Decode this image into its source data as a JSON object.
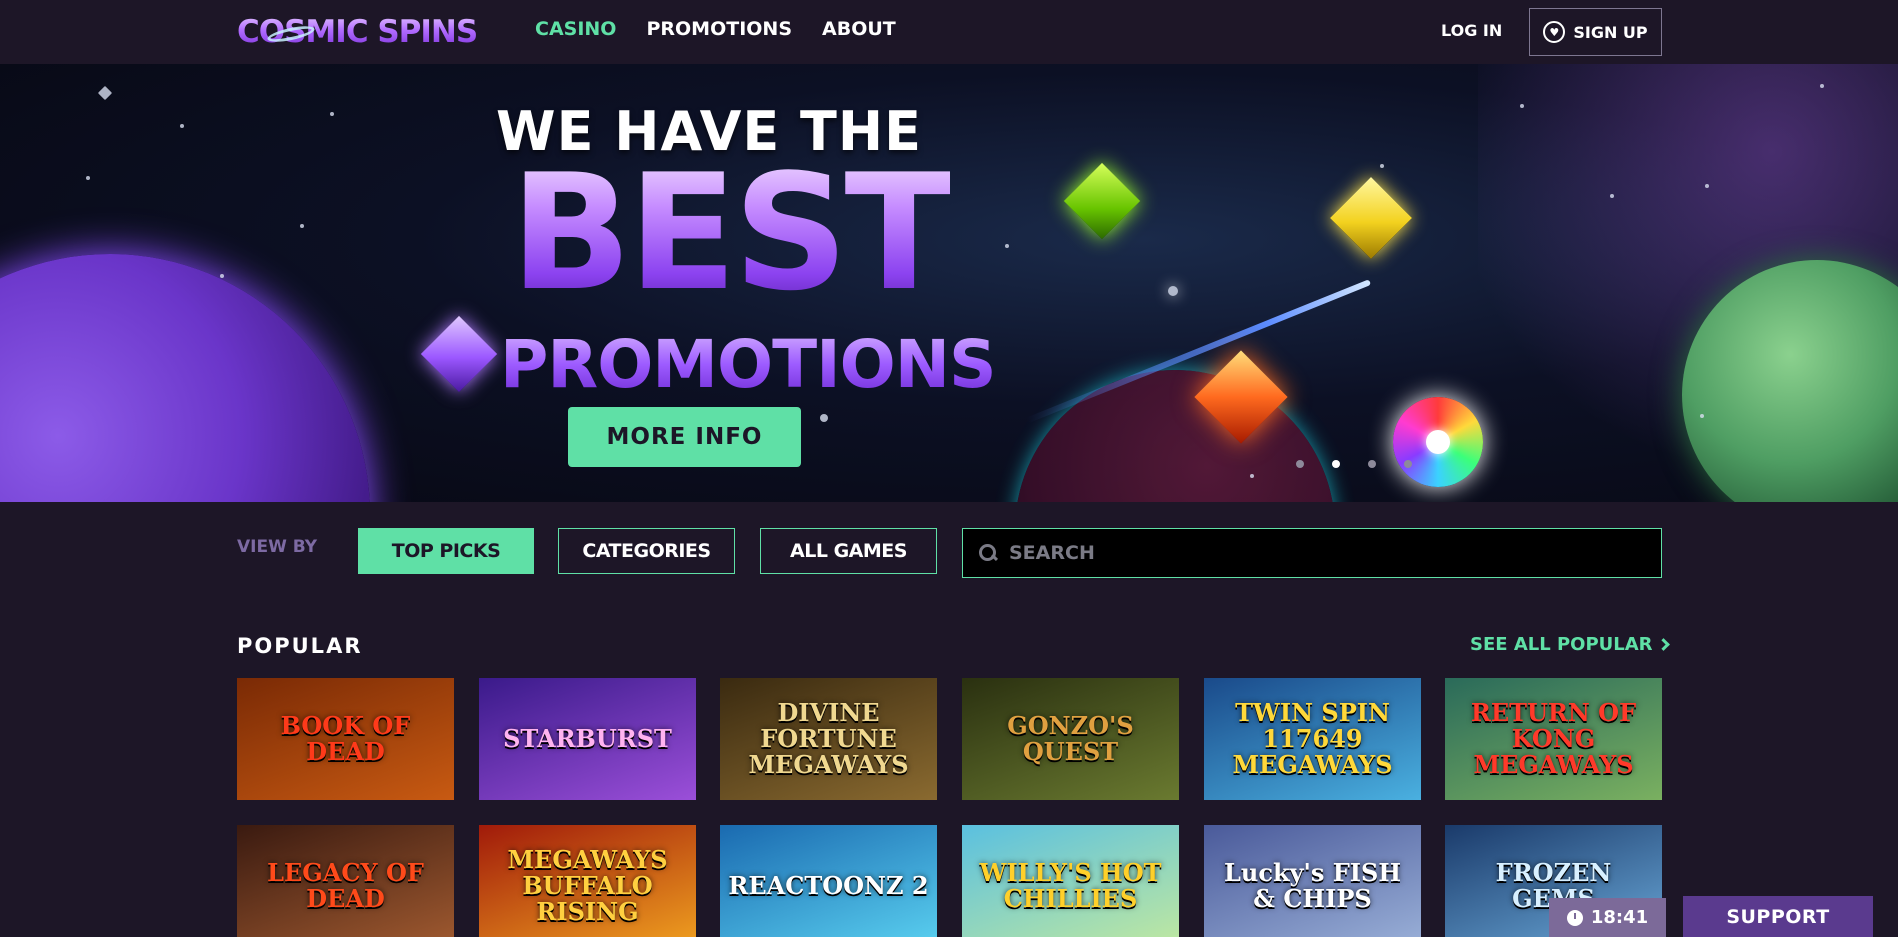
{
  "header": {
    "logo_text": "COSMIC SPINS",
    "nav": [
      {
        "label": "CASINO",
        "active": true
      },
      {
        "label": "PROMOTIONS",
        "active": false
      },
      {
        "label": "ABOUT",
        "active": false
      }
    ],
    "login_label": "LOG IN",
    "signup_label": "SIGN UP"
  },
  "hero": {
    "line1": "WE HAVE THE",
    "line2": "BEST",
    "line3": "PROMOTIONS",
    "cta_label": "MORE INFO",
    "carousel_dots": 4,
    "active_dot": 2
  },
  "view_bar": {
    "label": "VIEW BY",
    "buttons": [
      {
        "label": "TOP PICKS",
        "active": true
      },
      {
        "label": "CATEGORIES",
        "active": false
      },
      {
        "label": "ALL GAMES",
        "active": false
      }
    ],
    "search_placeholder": "SEARCH"
  },
  "popular": {
    "title": "POPULAR",
    "see_all_label": "SEE ALL POPULAR",
    "games": [
      {
        "title": "BOOK OF DEAD",
        "colors": [
          "#7a2a05",
          "#c85a12"
        ],
        "text_color": "#ff3a1a"
      },
      {
        "title": "STARBURST",
        "colors": [
          "#3a1a8a",
          "#9b4fd9"
        ],
        "text_color": "#ffb3f0"
      },
      {
        "title": "DIVINE FORTUNE MEGAWAYS",
        "colors": [
          "#3a2a10",
          "#8a6a30"
        ],
        "text_color": "#f0d890"
      },
      {
        "title": "GONZO'S QUEST",
        "colors": [
          "#2a3010",
          "#6a7a30"
        ],
        "text_color": "#e0a040"
      },
      {
        "title": "TWIN SPIN 117649 MEGAWAYS",
        "colors": [
          "#1a4a8a",
          "#4ab0e0"
        ],
        "text_color": "#ffd83a"
      },
      {
        "title": "RETURN OF KONG MEGAWAYS",
        "colors": [
          "#2a6a5a",
          "#7ab060"
        ],
        "text_color": "#ff3a2a"
      },
      {
        "title": "LEGACY OF DEAD",
        "colors": [
          "#3a1a10",
          "#a05a30"
        ],
        "text_color": "#ff4a1a"
      },
      {
        "title": "MEGAWAYS BUFFALO RISING",
        "colors": [
          "#a01a0a",
          "#f0a020"
        ],
        "text_color": "#ffd040"
      },
      {
        "title": "REACTOONZ 2",
        "colors": [
          "#1a6ab0",
          "#5ad0f0"
        ],
        "text_color": "#ffffff"
      },
      {
        "title": "WILLY'S HOT CHILLIES",
        "colors": [
          "#5ac0e0",
          "#c0e8a0"
        ],
        "text_color": "#ffd02a"
      },
      {
        "title": "Lucky's FISH & CHIPS",
        "colors": [
          "#4a5a9a",
          "#9ab0d8"
        ],
        "text_color": "#ffffff"
      },
      {
        "title": "FROZEN GEMS",
        "colors": [
          "#1a3a6a",
          "#6aa8d8"
        ],
        "text_color": "#d8f0ff"
      }
    ]
  },
  "widgets": {
    "clock_time": "18:41",
    "support_label": "SUPPORT"
  }
}
